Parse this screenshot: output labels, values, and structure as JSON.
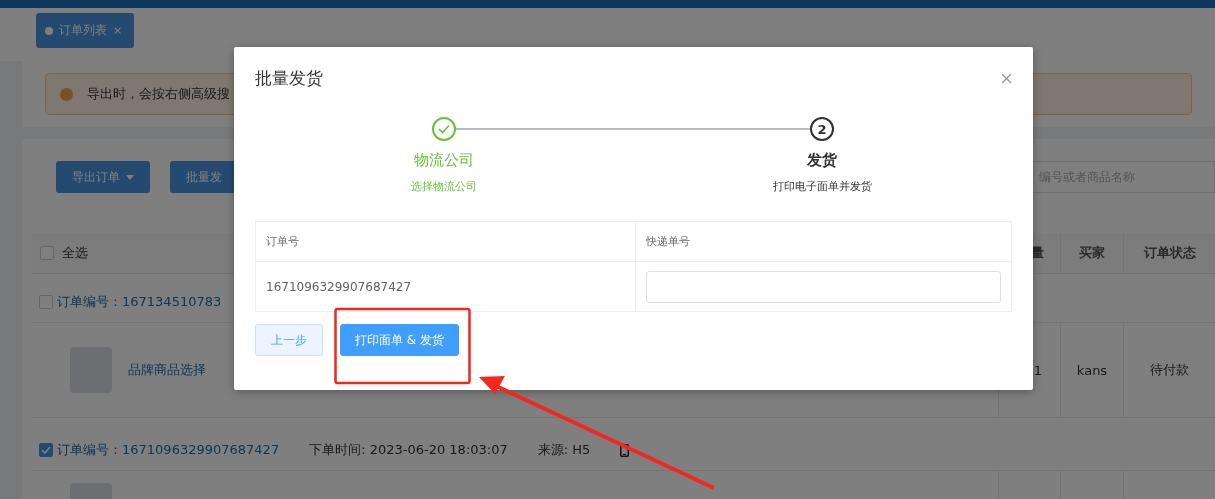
{
  "tabs": [
    {
      "label": "订单列表",
      "close": "×",
      "selected": true
    }
  ],
  "alert": {
    "text": "导出时，会按右侧高级搜"
  },
  "toolbar": {
    "buttons": [
      {
        "label": "导出订单",
        "kind": "dropdown"
      },
      {
        "label": "批量发",
        "kind": "plain"
      }
    ],
    "search": {
      "placeholder": "编号或者商品名称"
    }
  },
  "orders_table": {
    "select_all": {
      "label": "全选",
      "checked": false
    },
    "columns": [
      "量",
      "买家",
      "订单状态"
    ],
    "orders": [
      {
        "checked": false,
        "order_no": "订单编号：167134510783",
        "items": [
          {
            "name": "品牌商品选择",
            "qty": "1",
            "buyer": "kans",
            "status": "待付款"
          }
        ]
      },
      {
        "checked": true,
        "order_no": "订单编号：1671096329907687427",
        "time": "下单时间: 2023-06-20 18:03:07",
        "source": "来源: H5"
      }
    ]
  },
  "dialog": {
    "title": "批量发货",
    "steps": [
      {
        "title": "物流公司",
        "description": "选择物流公司",
        "done": true
      },
      {
        "title": "发货",
        "description": "打印电子面单并发货",
        "done": false,
        "number": "2"
      }
    ],
    "table": {
      "columns": [
        "订单号",
        "快递单号"
      ],
      "rows": [
        {
          "order_no": "1671096329907687427"
        }
      ]
    },
    "buttons": [
      {
        "label": "上一步",
        "kind": "default"
      },
      {
        "label": "打印面单 & 发货",
        "kind": "primary"
      }
    ]
  }
}
